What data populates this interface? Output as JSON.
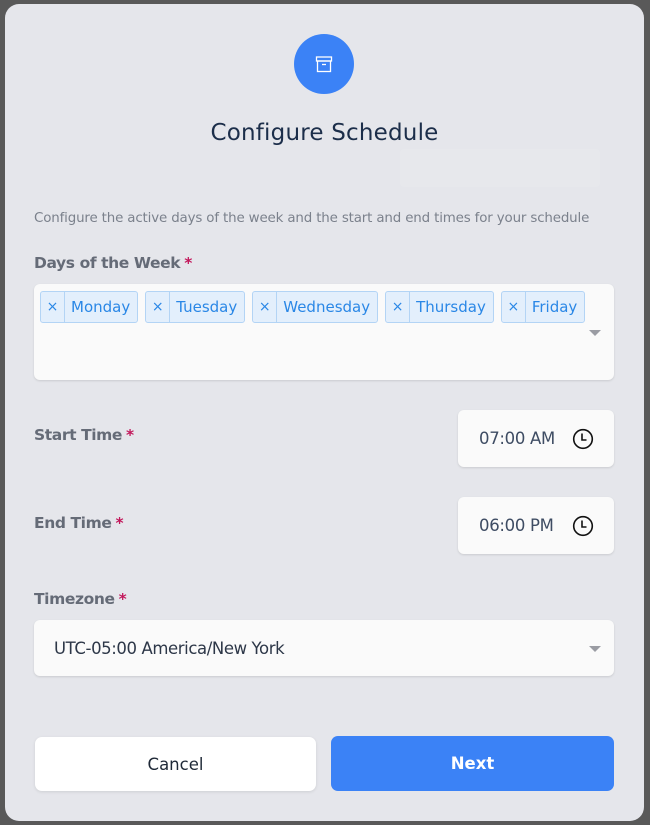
{
  "dialog": {
    "icon": "archive-box-icon",
    "title": "Configure Schedule",
    "description": "Configure the active days of the week and the start and end times for your schedule"
  },
  "days_of_week": {
    "label": "Days of the Week",
    "required_marker": "*",
    "remove_glyph": "×",
    "selected": [
      {
        "label": "Monday"
      },
      {
        "label": "Tuesday"
      },
      {
        "label": "Wednesday"
      },
      {
        "label": "Thursday"
      },
      {
        "label": "Friday"
      }
    ]
  },
  "start_time": {
    "label": "Start Time",
    "required_marker": "*",
    "value": "07:00 AM",
    "icon": "clock-icon"
  },
  "end_time": {
    "label": "End Time",
    "required_marker": "*",
    "value": "06:00 PM",
    "icon": "clock-icon"
  },
  "timezone": {
    "label": "Timezone",
    "required_marker": "*",
    "value": "UTC-05:00 America/New York"
  },
  "actions": {
    "cancel_label": "Cancel",
    "next_label": "Next"
  },
  "colors": {
    "accent": "#3b82f6",
    "required": "#c2185b",
    "chip_text": "#2a87e6",
    "chip_bg": "#e3effc"
  }
}
